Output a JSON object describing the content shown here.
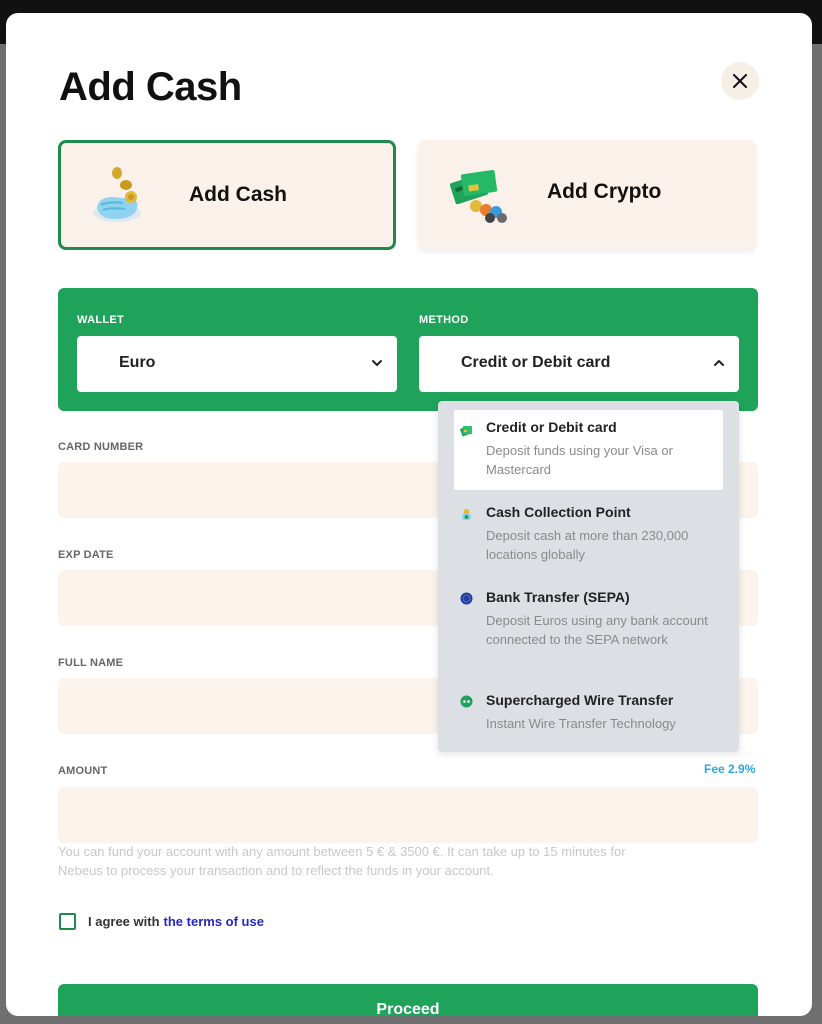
{
  "modal": {
    "title": "Add Cash",
    "close_icon": "close-icon"
  },
  "tabs": [
    {
      "label": "Add Cash",
      "icon": "coin-hand-icon",
      "active": true
    },
    {
      "label": "Add Crypto",
      "icon": "crypto-card-icon",
      "active": false
    }
  ],
  "wallet": {
    "label": "WALLET",
    "value": "Euro"
  },
  "method": {
    "label": "METHOD",
    "value": "Credit or Debit card",
    "expanded": true,
    "options": [
      {
        "title": "Credit or Debit card",
        "description": "Deposit funds using your Visa or Mastercard",
        "icon": "card-icon",
        "selected": true
      },
      {
        "title": "Cash Collection Point",
        "description": "Deposit cash at more than 230,000 locations globally",
        "icon": "cash-point-icon",
        "selected": false
      },
      {
        "title": "Bank Transfer (SEPA)",
        "description": "Deposit Euros using any bank account connected to the SEPA network",
        "icon": "eu-bank-icon",
        "selected": false
      },
      {
        "title": "Supercharged Wire Transfer",
        "description": "Instant Wire Transfer Technology",
        "icon": "wire-transfer-icon",
        "selected": false
      }
    ]
  },
  "form": {
    "card_number_label": "CARD NUMBER",
    "exp_date_label": "EXP DATE",
    "full_name_label": "FULL NAME",
    "amount_label": "AMOUNT",
    "card_number_value": "",
    "exp_date_value": "",
    "full_name_value": "",
    "amount_value": ""
  },
  "fee": "Fee 2.9%",
  "hint": "You can fund your account with any amount between  5 € & 3500 €.  It can take up to 15 minutes for Nebeus to process your transaction and to reflect the funds in your account.",
  "agree": {
    "text": "I agree with",
    "link": "the terms of use",
    "checked": false
  },
  "proceed_label": "Proceed",
  "colors": {
    "accent": "#1fa35b",
    "tab_bg": "#f9f1ea",
    "link": "#2626c9",
    "fee": "#2aa6e8"
  }
}
